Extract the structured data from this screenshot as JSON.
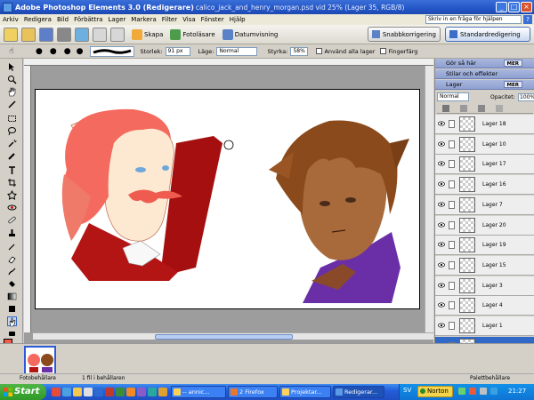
{
  "window": {
    "app_title": "Adobe Photoshop Elements 3.0 (Redigerare)",
    "doc_title": "calico_jack_and_henry_morgan.psd vid 25% (Lager 35, RGB/8)"
  },
  "menu": [
    "Arkiv",
    "Redigera",
    "Bild",
    "Förbättra",
    "Lager",
    "Markera",
    "Filter",
    "Visa",
    "Fönster",
    "Hjälp"
  ],
  "help": {
    "placeholder": "Skriv in en fråga för hjälpen"
  },
  "shortcuts": {
    "skapa": "Skapa",
    "fotolasare": "Fotoläsare",
    "datumvisning": "Datumvisning",
    "snabbkorrigering": "Snabbkorrigering",
    "standardredigering": "Standardredigering"
  },
  "options": {
    "size_label": "Storlek:",
    "size_value": "91 px",
    "mode_label": "Läge:",
    "mode_value": "Normal",
    "strength_label": "Styrka:",
    "strength_value": "58%",
    "all_layers": "Använd alla lager",
    "finger": "Fingerfärg"
  },
  "palettes": {
    "how_to": "Gör så här",
    "styles": "Stilar och effekter",
    "layers": "Lager",
    "more": "MER",
    "blend_mode": "Normal",
    "opacity_label": "Opacitet:",
    "opacity_value": "100%"
  },
  "layers": [
    "Lager 18",
    "Lager 10",
    "Lager 17",
    "Lager 16",
    "Lager 7",
    "Lager 20",
    "Lager 19",
    "Lager 15",
    "Lager 3",
    "Lager 4",
    "Lager 1",
    "Lager..."
  ],
  "photobin": {
    "label": "Fotobehållare",
    "count": "1 fil i behållaren",
    "palette": "Palettbehållare"
  },
  "taskbar": {
    "start": "Start",
    "items": [
      "-- annic...",
      "2 Firefox",
      "Projektar...",
      "Redigerar...",
      "SV",
      "Norton"
    ],
    "clock": "21:27"
  },
  "colors": {
    "foreground": "#f05a4a",
    "background": "#ffffff",
    "title_blue": "#2456c8",
    "selected_layer": "#3169c6"
  }
}
